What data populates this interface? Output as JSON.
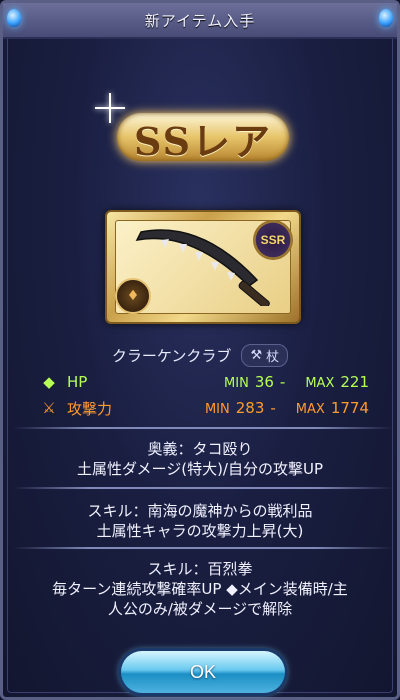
{
  "dialog": {
    "title": "新アイテム入手",
    "rarity_label": "SSレア",
    "ssr_badge": "SSR"
  },
  "item": {
    "name": "クラーケンクラブ",
    "type_label": "杖",
    "type_icon": "hammer-icon",
    "element_icon": "earth-element-icon"
  },
  "stats": {
    "hp": {
      "label": "HP",
      "min_tag": "MIN",
      "min": "36",
      "max_tag": "MAX",
      "max": "221",
      "color": "#b6ff55"
    },
    "attack": {
      "label": "攻撃力",
      "min_tag": "MIN",
      "min": "283",
      "max_tag": "MAX",
      "max": "1774",
      "color": "#ff9a2e"
    }
  },
  "ougi": {
    "line1": "奥義：タコ殴り",
    "line2": "土属性ダメージ(特大)/自分の攻撃UP"
  },
  "skill1": {
    "line1": "スキル：南海の魔神からの戦利品",
    "line2": "土属性キャラの攻撃力上昇(大)"
  },
  "skill2": {
    "line1": "スキル：百烈拳",
    "line2": "毎ターン連続攻撃確率UP ◆メイン装備時/主",
    "line3": "人公のみ/被ダメージで解除"
  },
  "buttons": {
    "ok": "OK"
  }
}
